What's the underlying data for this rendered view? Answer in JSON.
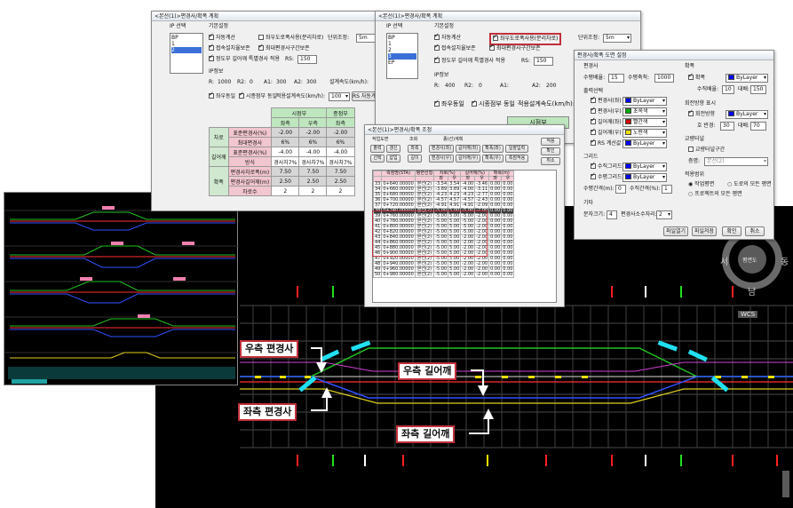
{
  "win1": {
    "title": "<본선(1)>편경사/확폭 계획",
    "ip_label": "IP 선택",
    "ip_items": [
      "BP",
      "1",
      "2"
    ],
    "basic_label": "기본설정",
    "auto_calc": "자동계산",
    "lr_road": "좌우도로폭사용(분리차로)",
    "unit_adjust": "단위조정:",
    "unit_value": "5m",
    "transition": "접속설치율보존",
    "max_sec": "최대편경사구간보존",
    "widen_opt": "정도부 길어깨 특별경사 적용",
    "rs_label": "RS:",
    "rs_value": "150",
    "ip_info_label": "IP정보",
    "r_label": "R:",
    "r_value": "1000",
    "r2_label": "R2:",
    "r2_value": "0",
    "a1_label": "A1:",
    "a1_value": "300",
    "a2_label": "A2:",
    "a2_value": "300",
    "design_speed": "설계속도(km/h):",
    "same_lr": "좌우동일",
    "same_end": "시종점부 동일",
    "apply_speed": "적용설계속도(km/h):",
    "apply_speed_value": "100",
    "rs_btn": "RS 자동계산",
    "table": {
      "head1": [
        "시점부",
        "종점부"
      ],
      "head2": [
        "좌측",
        "우측",
        "좌측"
      ],
      "rows": [
        {
          "group": "차로",
          "name": "표준편경사(%)",
          "vals": [
            "-2.00",
            "-2.00",
            "-2.00"
          ]
        },
        {
          "group": "",
          "name": "최대편경사",
          "vals": [
            "6%",
            "6%",
            "6%"
          ]
        },
        {
          "group": "길어깨",
          "name": "표준편경사(%)",
          "vals": [
            "-4.00",
            "-4.00",
            "-4.00"
          ]
        },
        {
          "group": "",
          "name": "방식",
          "vals": [
            "경사차7%",
            "경사차7%",
            "경사차7%"
          ]
        },
        {
          "group": "확폭",
          "name": "편경사차로폭(m)",
          "vals": [
            "7.50",
            "7.50",
            "7.50"
          ]
        },
        {
          "group": "",
          "name": "편경사길어깨(m)",
          "vals": [
            "2.50",
            "2.50",
            "2.50"
          ]
        },
        {
          "group": "",
          "name": "차로수",
          "vals": [
            "2",
            "2",
            "2"
          ]
        }
      ]
    }
  },
  "win2": {
    "title": "<본선(1)>편경사/확폭 계획",
    "ip_label": "IP 선택",
    "ip_items": [
      "BP",
      "1",
      "2",
      "3",
      "EP"
    ],
    "basic_label": "기본설정",
    "auto_calc": "자동계산",
    "lr_road": "좌우도로폭사용(분리차로)",
    "unit_adjust": "단위조정:",
    "unit_value": "5m",
    "transition": "접속설치율보존",
    "max_sec": "최대편경사구간보존",
    "widen_opt": "정도부 길어깨 특별경사 적용",
    "rs_label": "RS:",
    "rs_value": "150",
    "ip_info_label": "IP정보",
    "r_label": "R:",
    "r_value": "400",
    "r2_label": "R2:",
    "r2_value": "0",
    "a1_label": "A1:",
    "a2_label": "A2:",
    "a2_value": "200",
    "same_lr": "좌우동일",
    "same_end": "시종점부 동일",
    "apply_speed": "적용설계속도(km/h):",
    "start_head": "시점부"
  },
  "win3": {
    "title": "<본선(1)>편경사/확폭 조정",
    "work_label": "작업도면",
    "view_label": "조회",
    "station_plan": "종(선)계획",
    "btns_row1": [
      "출력",
      "갱신",
      "좌측"
    ],
    "btns_row2": [
      "선택",
      "삽입",
      "길이"
    ],
    "mid_row1": [
      "편경사(좌)",
      "길어깨(좌)",
      "확폭(좌)",
      "일괄입력"
    ],
    "mid_row2": [
      "편경사(우)",
      "길어깨(우)",
      "확폭(우)",
      "측점적용"
    ],
    "apply_btn": "적용",
    "confirm_btn": "확인",
    "cancel_btn": "취소",
    "col_heads": [
      "측점명(STA)",
      "평면선형",
      "차로(%)",
      "",
      "길어깨(%)",
      "",
      "확폭(m)",
      ""
    ],
    "sub_heads": [
      "",
      "",
      "좌",
      "우",
      "좌",
      "우",
      "좌",
      "우"
    ],
    "rows": [
      [
        "33",
        "0+640.00000",
        "본선(2)",
        "-3.54",
        "3.54",
        "-4.00",
        "-3.46",
        "0.00",
        "0.00"
      ],
      [
        "34",
        "0+660.00000",
        "본선(2)",
        "-3.89",
        "3.89",
        "-4.00",
        "-3.11",
        "0.00",
        "0.00"
      ],
      [
        "35",
        "0+680.00000",
        "본선(2)",
        "-4.23",
        "4.23",
        "-4.23",
        "-2.77",
        "0.00",
        "0.00"
      ],
      [
        "36",
        "0+700.00000",
        "본선(2)",
        "-4.57",
        "4.57",
        "-4.57",
        "-2.43",
        "0.00",
        "0.00"
      ],
      [
        "37",
        "0+720.00000",
        "본선(2)",
        "-4.91",
        "4.91",
        "-4.91",
        "-2.09",
        "0.00",
        "0.00"
      ],
      [
        "38",
        "0+740.00000",
        "본선(2)",
        "-5.00",
        "5.00",
        "-5.00",
        "-2.00",
        "0.00",
        "0.00"
      ],
      [
        "39",
        "0+760.00000",
        "본선(2)",
        "-5.00",
        "5.00",
        "-5.00",
        "-2.00",
        "0.00",
        "0.00"
      ],
      [
        "40",
        "0+780.00000",
        "본선(2)",
        "-5.00",
        "5.00",
        "-5.00",
        "-2.00",
        "0.00",
        "0.00"
      ],
      [
        "41",
        "0+800.00000",
        "본선(2)",
        "-5.00",
        "5.00",
        "-5.00",
        "-2.00",
        "0.00",
        "0.00"
      ],
      [
        "42",
        "0+820.00000",
        "본선(2)",
        "-5.00",
        "5.00",
        "-5.00",
        "-2.00",
        "0.00",
        "0.00"
      ],
      [
        "43",
        "0+840.00000",
        "본선(2)",
        "-5.00",
        "5.00",
        "-2.00",
        "-2.00",
        "0.00",
        "0.00"
      ],
      [
        "44",
        "0+860.00000",
        "본선(2)",
        "-5.00",
        "5.00",
        "-2.00",
        "-2.00",
        "0.00",
        "0.00"
      ],
      [
        "45",
        "0+880.00000",
        "본선(2)",
        "-5.00",
        "5.00",
        "-2.00",
        "-2.00",
        "0.00",
        "0.00"
      ],
      [
        "46",
        "0+900.00000",
        "본선(2)",
        "-5.00",
        "5.00",
        "-2.00",
        "-2.00",
        "0.00",
        "0.00"
      ],
      [
        "47",
        "0+920.00000",
        "본선(2)",
        "-5.00",
        "5.00",
        "-2.00",
        "-2.00",
        "0.00",
        "0.00"
      ],
      [
        "48",
        "0+940.00000",
        "본선(2)",
        "-5.00",
        "5.00",
        "-2.00",
        "-2.00",
        "0.00",
        "0.00"
      ],
      [
        "49",
        "0+960.00000",
        "본선(2)",
        "-5.00",
        "5.00",
        "-2.00",
        "-2.00",
        "0.00",
        "0.00"
      ],
      [
        "50",
        "0+980.00000",
        "본선(2)",
        "-5.00",
        "5.00",
        "-2.00",
        "-2.00",
        "0.00",
        "0.00"
      ]
    ]
  },
  "win4": {
    "title": "편경사/확폭 도면 설정",
    "sec_scale": "편경사",
    "h_scale": "수평배율:",
    "h_scale_value": "15",
    "v_scale": "수평축척:",
    "v_scale_value": "1000",
    "output_sel": "출력선택",
    "items": [
      {
        "label": "편경사(좌)",
        "color": "#0000ff",
        "name": "ByLayer"
      },
      {
        "label": "편경사(우)",
        "color": "#00aa00",
        "name": "초록색"
      },
      {
        "label": "길어깨(좌)",
        "color": "#cc0000",
        "name": "빨간색"
      },
      {
        "label": "길어깨(우)",
        "color": "#f0e000",
        "name": "노란색"
      },
      {
        "label": "RS 계산값",
        "color": "#0000ff",
        "name": "ByLayer"
      }
    ],
    "grid_label": "그리드",
    "grid_v": "수직그리드",
    "grid_h": "수평그리드",
    "grid_v_color": "ByLayer",
    "grid_h_color": "ByLayer",
    "v_interval": "수평간격(m):",
    "v_interval_value": "0",
    "v_interval2": "수직간격(%):",
    "v_interval2_value": "1",
    "etc_label": "기타",
    "text_size": "문자크기:",
    "text_size_value": "4",
    "dec_label": "편경사소수자리:",
    "dec_value": "2",
    "widen_label": "확폭",
    "widen_item": "확폭",
    "widen_color": "ByLayer",
    "v_scale2": "수직배율:",
    "v_scale2_value": "10",
    "v_scale3": "대배:",
    "v_scale3_value": "150",
    "curve_label": "회전방향 표시",
    "curve_item": "회전방향",
    "curve_color": "ByLayer",
    "arc_label": "호 반경:",
    "arc_value": "30",
    "arc_label2": "대배:",
    "arc_value2": "70",
    "cross_label": "교량터널",
    "cross_item": "교량터널구간",
    "layer_label": "층명:",
    "layer_value": "본선(2)",
    "apply_range": "적용범위",
    "range1": "작업평면",
    "range2": "도로의 모든 평면",
    "range3": "프로젝트의 모든 평면",
    "file_open": "파일열기",
    "file_save": "파일저장",
    "confirm": "확인",
    "cancel": "취소"
  },
  "cad_label": "IC",
  "compass": {
    "west": "서",
    "east": "동",
    "south": "남",
    "center": "평면도"
  },
  "wcs": "WCS",
  "callouts": {
    "right_super": "우측 편경사",
    "left_super": "좌측 편경사",
    "right_shoulder": "우측 길어깨",
    "left_shoulder": "좌측 길어깨"
  }
}
